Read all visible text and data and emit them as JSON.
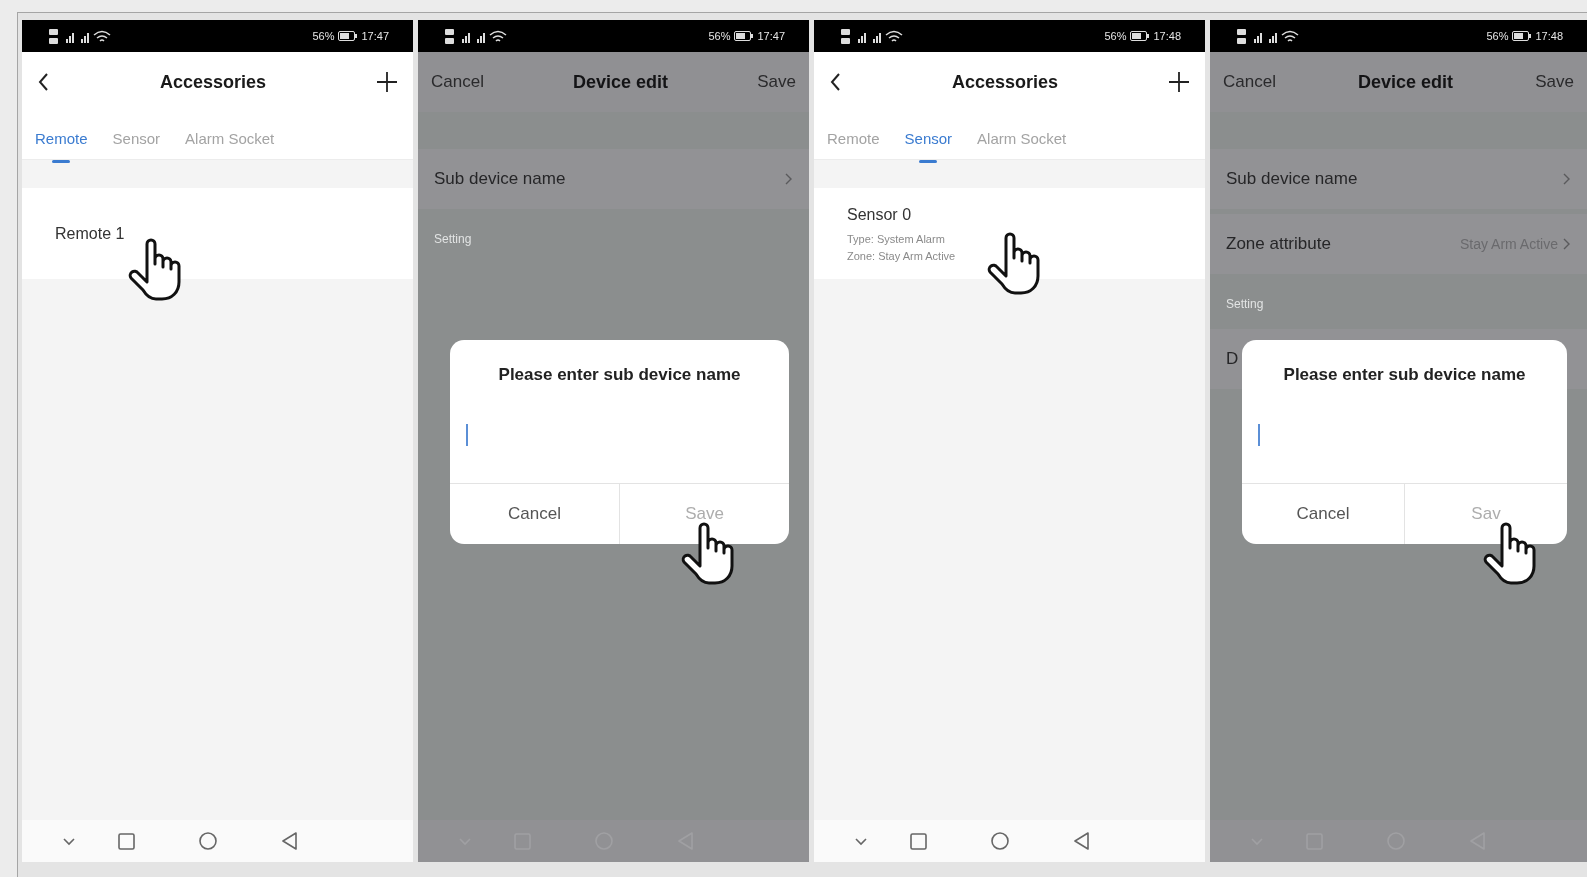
{
  "panels": [
    {
      "kind": "list",
      "status": {
        "battery": "56%",
        "time": "17:47"
      },
      "header": {
        "title": "Accessories"
      },
      "tabs": [
        {
          "label": "Remote",
          "selected": true
        },
        {
          "label": "Sensor",
          "selected": false
        },
        {
          "label": "Alarm Socket",
          "selected": false
        }
      ],
      "items": [
        {
          "name": "Remote 1"
        }
      ]
    },
    {
      "kind": "edit",
      "status": {
        "battery": "56%",
        "time": "17:47"
      },
      "header": {
        "left": "Cancel",
        "title": "Device edit",
        "right": "Save"
      },
      "rows": [
        {
          "label": "Sub device name"
        }
      ],
      "section": "Setting",
      "dialog": {
        "title": "Please enter sub device name",
        "buttons": [
          {
            "label": "Cancel",
            "disabled": false
          },
          {
            "label": "Save",
            "disabled": true
          }
        ]
      }
    },
    {
      "kind": "list",
      "status": {
        "battery": "56%",
        "time": "17:48"
      },
      "header": {
        "title": "Accessories"
      },
      "tabs": [
        {
          "label": "Remote",
          "selected": false
        },
        {
          "label": "Sensor",
          "selected": true
        },
        {
          "label": "Alarm Socket",
          "selected": false
        }
      ],
      "items": [
        {
          "name": "Sensor 0",
          "details": [
            "Type: System Alarm",
            "Zone: Stay Arm Active"
          ]
        }
      ]
    },
    {
      "kind": "edit",
      "status": {
        "battery": "56%",
        "time": "17:48"
      },
      "header": {
        "left": "Cancel",
        "title": "Device edit",
        "right": "Save"
      },
      "rows": [
        {
          "label": "Sub device name"
        },
        {
          "label": "Zone attribute",
          "value": "Stay Arm Active"
        }
      ],
      "section": "Setting",
      "section_rows": [
        {
          "label": "D"
        }
      ],
      "dialog": {
        "title": "Please enter sub device name",
        "buttons": [
          {
            "label": "Cancel",
            "disabled": false
          },
          {
            "label": "Sav",
            "disabled": true
          }
        ]
      }
    }
  ]
}
